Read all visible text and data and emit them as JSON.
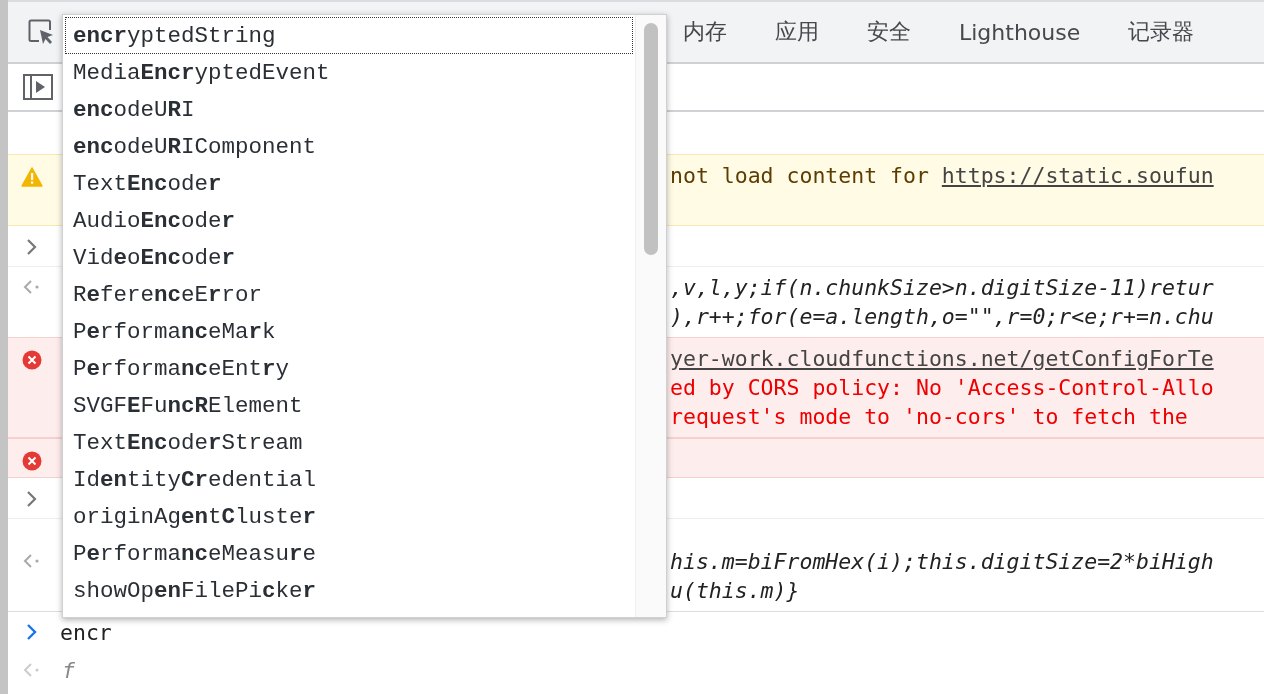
{
  "toolbar": {
    "tabs": [
      {
        "label": "内存",
        "selected": false
      },
      {
        "label": "应用",
        "selected": false
      },
      {
        "label": "安全",
        "selected": false
      },
      {
        "label": "Lighthouse",
        "selected": false
      },
      {
        "label": "记录器",
        "selected": false
      }
    ]
  },
  "console": {
    "messages": [
      {
        "kind": "warning",
        "lines": [
          {
            "text": "not load content for ",
            "link": "https://static.soufun"
          }
        ]
      },
      {
        "kind": "input"
      },
      {
        "kind": "result",
        "lines": [
          {
            "text": ",v,l,y;if(n.chunkSize>n.digitSize-11)retur"
          },
          {
            "text": "),r++;for(e=a.length,o=\"\",r=0;r<e;r+=n.chu"
          }
        ]
      },
      {
        "kind": "error",
        "lines": [
          {
            "link": "yer-work.cloudfunctions.net/getConfigForTe"
          },
          {
            "text": "ed by CORS policy: No 'Access-Control-Allo"
          },
          {
            "text": " request's mode to 'no-cors' to fetch the"
          }
        ]
      },
      {
        "kind": "error"
      },
      {
        "kind": "input"
      },
      {
        "kind": "result",
        "lines": [
          {
            "text": "his.m=biFromHex(i);this.digitSize=2*biHigh"
          },
          {
            "text": "u(this.m)}"
          }
        ]
      }
    ],
    "prompt": {
      "value": "encr"
    },
    "preview": {
      "text": "f"
    }
  },
  "autocomplete": {
    "items": [
      {
        "label": "**encr**yptedString",
        "selected": true
      },
      {
        "label": "Media**Encr**yptedEvent",
        "selected": false
      },
      {
        "label": "**enc**odeU**R**I",
        "selected": false
      },
      {
        "label": "**enc**odeU**R**IComponent",
        "selected": false
      },
      {
        "label": "Text**Enc**ode**r**",
        "selected": false
      },
      {
        "label": "Audio**Enc**ode**r**",
        "selected": false
      },
      {
        "label": "Vid**e**o**Enc**ode**r**",
        "selected": false
      },
      {
        "label": "R**e**fere**nc**eE**r**ror",
        "selected": false
      },
      {
        "label": "P**e**rforma**nc**eMa**r**k",
        "selected": false
      },
      {
        "label": "P**e**rforma**nc**eEnt**r**y",
        "selected": false
      },
      {
        "label": "SVGF**E**Fu**ncR**Element",
        "selected": false
      },
      {
        "label": "Text**Enc**ode**r**Stream",
        "selected": false
      },
      {
        "label": "Id**en**tity**Cr**edential",
        "selected": false
      },
      {
        "label": "originAg**en**t**C**luste**r**",
        "selected": false
      },
      {
        "label": "P**e**rforma**nc**eMeasu**r**e",
        "selected": false
      },
      {
        "label": "showOp**en**FilePi**c**ke**r**",
        "selected": false
      }
    ]
  }
}
